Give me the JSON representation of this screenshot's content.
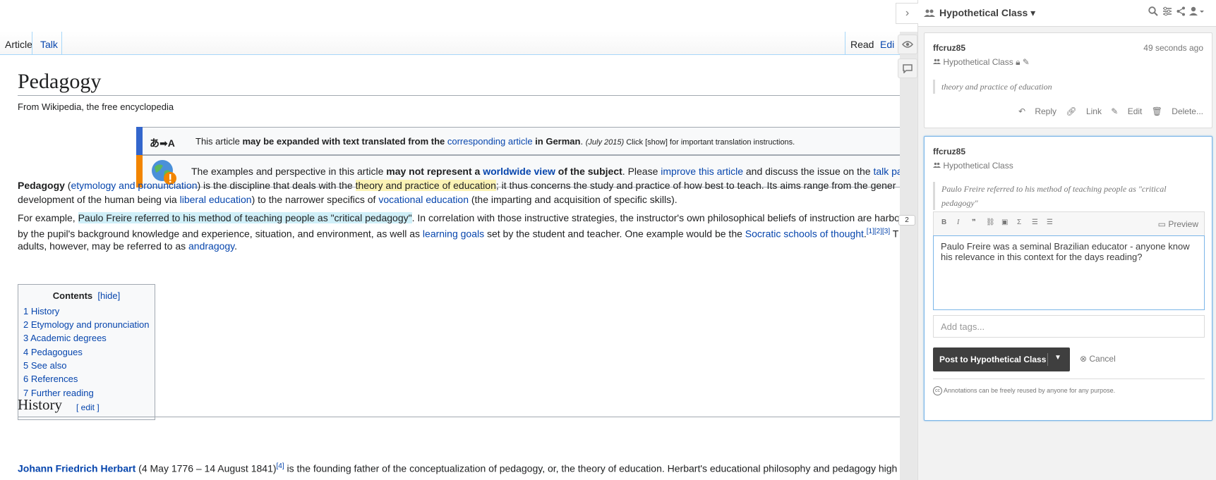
{
  "wiki": {
    "tabs": {
      "article": "Article",
      "talk": "Talk",
      "read": "Read",
      "edit": "Edi"
    },
    "title": "Pedagogy",
    "subtitle": "From Wikipedia, the free encyclopedia",
    "ambox1": {
      "icon": "あ➡A",
      "t1": "This article ",
      "t2": "may be expanded with text translated from the ",
      "link": "corresponding article",
      "t3": " in German",
      "t4": ". ",
      "date": "(July 2015)",
      "t5": " Click [show] for important translation instructions."
    },
    "ambox2": {
      "t1": "The examples and perspective in this article ",
      "t2": "may not represent a ",
      "link1": "worldwide view",
      "t3": " of the subject",
      "t4": ". Please ",
      "link2": "improve this article",
      "t5": " and discuss the issue on the ",
      "link3": "talk pa"
    },
    "p1": {
      "l1a": "Pedagogy",
      "l1b": " (",
      "l1c": "etymology and pronunciation",
      "l1d": ") is the discipline that deals with the ",
      "l1e": "theory and practice of education",
      "l1f": "; it thus concerns the study and practice of how best to teach. Its aims range from the gener",
      "l2a": "development of the human being via ",
      "l2b": "liberal education",
      "l2c": ") to the narrower specifics of ",
      "l2d": "vocational education",
      "l2e": " (the imparting and acquisition of specific skills)."
    },
    "p2": {
      "l1a": "For example, ",
      "l1b": "Paulo Freire referred to his method of teaching people as \"critical pedagogy\"",
      "l1c": ". In correlation with those instructive strategies, the instructor's own philosophical beliefs of instruction are harbo",
      "l2a": "by the pupil's background knowledge and experience, situation, and environment, as well as ",
      "l2b": "learning goals",
      "l2c": " set by the student and teacher. One example would be the ",
      "l2d": "Socratic schools of thought",
      "l2e": ".",
      "l2f": "[1][2][3]",
      "l2g": " T",
      "l3a": "adults, however, may be referred to as ",
      "l3b": "andragogy",
      "l3c": "."
    },
    "toc": {
      "heading": "Contents",
      "hide": "[hide]",
      "items": [
        "1 History",
        "2 Etymology and pronunciation",
        "3 Academic degrees",
        "4 Pedagogues",
        "5 See also",
        "6 References",
        "7 Further reading"
      ]
    },
    "history": {
      "heading": "History",
      "edit": "[ edit ]"
    },
    "p3": {
      "l1a": "Johann Friedrich Herbart",
      "l1b": " (4 May 1776 – 14 August 1841)",
      "l1c": "[4]",
      "l1d": " is the founding father of the conceptualization of pedagogy, or, the theory of education. Herbart's educational philosophy and pedagogy high"
    },
    "count_badge": "2"
  },
  "sidebar": {
    "group": "Hypothetical Class",
    "annotation1": {
      "user": "ffcruz85",
      "time": "49 seconds ago",
      "group": "Hypothetical Class",
      "quote": "theory and practice of education",
      "actions": {
        "reply": "Reply",
        "link": "Link",
        "edit": "Edit",
        "delete": "Delete..."
      }
    },
    "annotation2": {
      "user": "ffcruz85",
      "group": "Hypothetical Class",
      "quote": "Paulo Freire referred to his method of teaching people as \"critical pedagogy\"",
      "preview": "Preview",
      "text": "Paulo Freire was a seminal Brazilian educator - anyone know his relevance in this context for the days reading?",
      "tags_placeholder": "Add tags...",
      "post": "Post to Hypothetical Class",
      "cancel": "Cancel",
      "license": "Annotations can be freely reused by anyone for any purpose."
    }
  },
  "colors": {
    "ambox_translate": "#36c",
    "ambox_global": "#f28500",
    "highlight_yellow": "#fbf3b5",
    "highlight_blue": "#cfeff8",
    "link": "#0645ad"
  }
}
